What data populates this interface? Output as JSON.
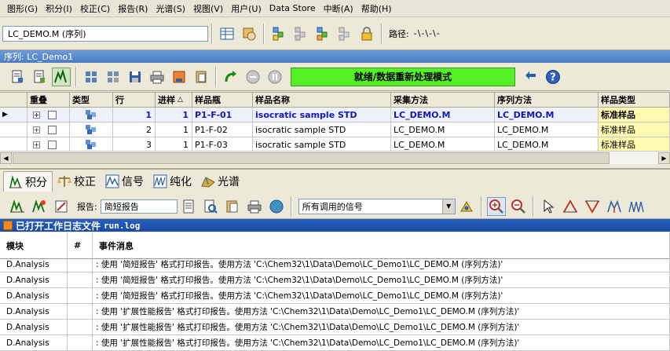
{
  "menu": [
    "图形(G)",
    "积分(I)",
    "校正(C)",
    "报告(R)",
    "光谱(S)",
    "视图(V)",
    "用户(U)",
    "Data Store",
    "中断(A)",
    "帮助(H)"
  ],
  "method_combo": "LC_DEMO.M (序列)",
  "path_label": "路径:",
  "path_value": "-\\-\\-\\-",
  "sequence_title": "序列: LC_Demo1",
  "status_mode": "就绪/数据重新处理模式",
  "seq_columns": [
    "重叠",
    "类型",
    "行",
    "进样",
    "样品瓶",
    "样品名称",
    "采集方法",
    "序列方法",
    "样品类型"
  ],
  "seq_rows": [
    {
      "line": "1",
      "inj": "1",
      "vial": "P1-F-01",
      "name": "isocratic sample STD",
      "acq": "LC_DEMO.M",
      "seq": "LC_DEMO.M",
      "type": "标准样品"
    },
    {
      "line": "2",
      "inj": "1",
      "vial": "P1-F-02",
      "name": "isocratic sample STD",
      "acq": "LC_DEMO.M",
      "seq": "LC_DEMO.M",
      "type": "标准样品"
    },
    {
      "line": "3",
      "inj": "1",
      "vial": "P1-F-03",
      "name": "isocratic sample  STD",
      "acq": "LC_DEMO.M",
      "seq": "LC_DEMO.M",
      "type": "标准样品"
    }
  ],
  "tabs": [
    "积分",
    "校正",
    "信号",
    "纯化",
    "光谱"
  ],
  "report_label": "报告:",
  "report_value": "简短报告",
  "signal_combo": "所有调用的信号",
  "log_title": "已打开工作日志文件",
  "log_filename": "run.log",
  "log_columns": [
    "模块",
    "#",
    "事件消息"
  ],
  "log_rows": [
    {
      "module": "D.Analysis",
      "msg": ": 使用 '简短报告' 格式打印报告。使用方法 'C:\\Chem32\\1\\Data\\Demo\\LC_Demo1\\LC_DEMO.M (序列方法)'"
    },
    {
      "module": "D.Analysis",
      "msg": ": 使用 '简短报告' 格式打印报告。使用方法 'C:\\Chem32\\1\\Data\\Demo\\LC_Demo1\\LC_DEMO.M (序列方法)'"
    },
    {
      "module": "D.Analysis",
      "msg": ": 使用 '简短报告' 格式打印报告。使用方法 'C:\\Chem32\\1\\Data\\Demo\\LC_Demo1\\LC_DEMO.M (序列方法)'"
    },
    {
      "module": "D.Analysis",
      "msg": ": 使用 '扩展性能报告' 格式打印报告。使用方法 'C:\\Chem32\\1\\Data\\Demo\\LC_Demo1\\LC_DEMO.M (序列方法)'"
    },
    {
      "module": "D.Analysis",
      "msg": ": 使用 '扩展性能报告' 格式打印报告。使用方法 'C:\\Chem32\\1\\Data\\Demo\\LC_Demo1\\LC_DEMO.M (序列方法)'"
    },
    {
      "module": "D.Analysis",
      "msg": ": 使用 '扩展性能报告' 格式打印报告。使用方法 'C:\\Chem32\\1\\Data\\Demo\\LC_Demo1\\LC_DEMO.M (序列方法)'"
    }
  ],
  "colors": {
    "status_green": "#55f028",
    "selected_text": "#1018b8",
    "sample_type_bg": "#fffab0",
    "log_title_bg": "#285fbf"
  }
}
